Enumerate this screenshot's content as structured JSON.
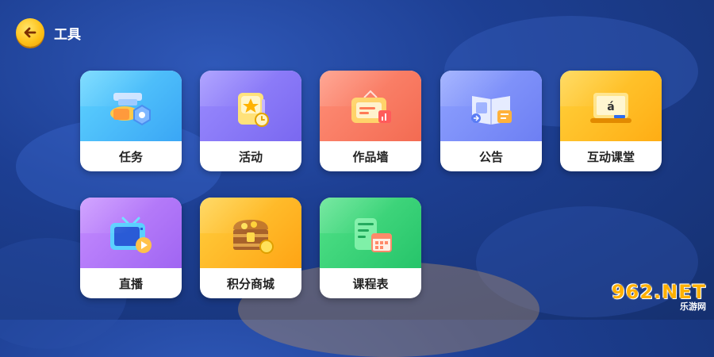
{
  "header": {
    "title": "工具"
  },
  "tools": [
    {
      "label": "任务",
      "icon": "task-icon"
    },
    {
      "label": "活动",
      "icon": "activity-icon"
    },
    {
      "label": "作品墙",
      "icon": "works-wall-icon"
    },
    {
      "label": "公告",
      "icon": "announcement-icon"
    },
    {
      "label": "互动课堂",
      "icon": "interactive-class-icon"
    },
    {
      "label": "直播",
      "icon": "live-tv-icon"
    },
    {
      "label": "积分商城",
      "icon": "treasure-chest-icon"
    },
    {
      "label": "课程表",
      "icon": "schedule-icon"
    }
  ],
  "colors": {
    "task": "#3aa6f5",
    "activity": "#7a68f0",
    "works_wall": "#f36b52",
    "announcement": "#6d7ff3",
    "interactive_class": "#ffad14",
    "live": "#a065f2",
    "points_mall": "#ffa414",
    "schedule": "#26c46a"
  },
  "watermark": {
    "logo": "962.NET",
    "sub": "乐游网"
  }
}
